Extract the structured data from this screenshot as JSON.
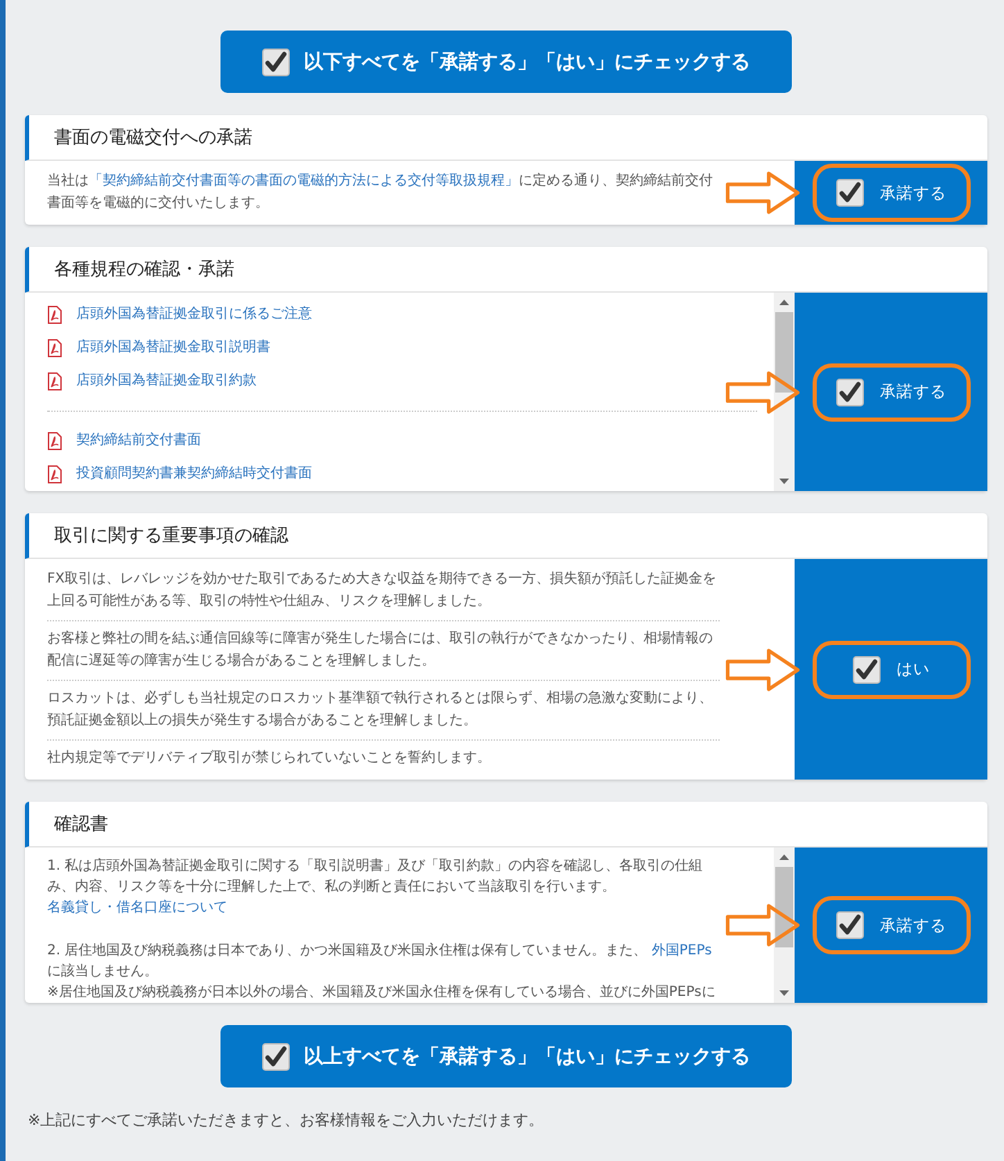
{
  "top_button": {
    "label": "以下すべてを「承諾する」「はい」にチェックする",
    "checked": true
  },
  "sections": [
    {
      "kind": "text",
      "title": "書面の電磁交付への承諾",
      "scrollable": false,
      "paragraphs": [
        [
          {
            "text": "当社は"
          },
          {
            "text": "「契約締結前交付書面等の書面の電磁的方法による交付等取扱規程」",
            "link": true
          },
          {
            "text": "に定める通り、契約締結前交付書面等を電磁的に交付いたします。"
          }
        ]
      ],
      "accept": {
        "label": "承諾する",
        "checked": true,
        "annotated": true
      }
    },
    {
      "kind": "documents",
      "title": "各種規程の確認・承諾",
      "scrollable": true,
      "groups": [
        [
          "店頭外国為替証拠金取引に係るご注意",
          "店頭外国為替証拠金取引説明書",
          "店頭外国為替証拠金取引約款"
        ],
        [
          "契約締結前交付書面",
          "投資顧問契約書兼契約締結時交付書面"
        ]
      ],
      "accept": {
        "label": "承諾する",
        "checked": true,
        "annotated": true
      }
    },
    {
      "kind": "text",
      "title": "取引に関する重要事項の確認",
      "scrollable": false,
      "paragraphs": [
        [
          {
            "text": "FX取引は、レバレッジを効かせた取引であるため大きな収益を期待できる一方、損失額が預託した証拠金を上回る可能性がある等、取引の特性や仕組み、リスクを理解しました。"
          }
        ],
        [
          {
            "text": "お客様と弊社の間を結ぶ通信回線等に障害が発生した場合には、取引の執行ができなかったり、相場情報の配信に遅延等の障害が生じる場合があることを理解しました。"
          }
        ],
        [
          {
            "text": "ロスカットは、必ずしも当社規定のロスカット基準額で執行されるとは限らず、相場の急激な変動により、預託証拠金額以上の損失が発生する場合があることを理解しました。"
          }
        ],
        [
          {
            "text": "社内規定等でデリバティブ取引が禁じられていないことを誓約します。"
          }
        ]
      ],
      "accept": {
        "label": "はい",
        "checked": true,
        "annotated": true
      }
    },
    {
      "kind": "statements",
      "title": "確認書",
      "scrollable": true,
      "blocks": [
        [
          [
            {
              "text": "1. 私は店頭外国為替証拠金取引に関する「取引説明書」及び「取引約款」の内容を確認し、各取引の仕組み、内容、リスク等を十分に理解した上で、私の判断と責任において当該取引を行います。"
            }
          ],
          [
            {
              "text": "名義貸し・借名口座について",
              "link": true
            }
          ]
        ],
        [
          [
            {
              "text": "2. 居住地国及び納税義務は日本であり、かつ米国籍及び米国永住権は保有していません。また、 "
            },
            {
              "text": "外国PEPs",
              "link": true
            },
            {
              "text": "に該当しません。"
            }
          ],
          [
            {
              "text": "※居住地国及び納税義務が日本以外の場合、米国籍及び米国永住権を保有している場合、並びに外国PEPsに"
            }
          ]
        ]
      ],
      "accept": {
        "label": "承諾する",
        "checked": true,
        "annotated": true
      }
    }
  ],
  "bottom_button": {
    "label": "以上すべてを「承諾する」「はい」にチェックする",
    "checked": true
  },
  "note": "※上記にすべてご承諾いただきますと、お客様情報をご入力いただけます。"
}
